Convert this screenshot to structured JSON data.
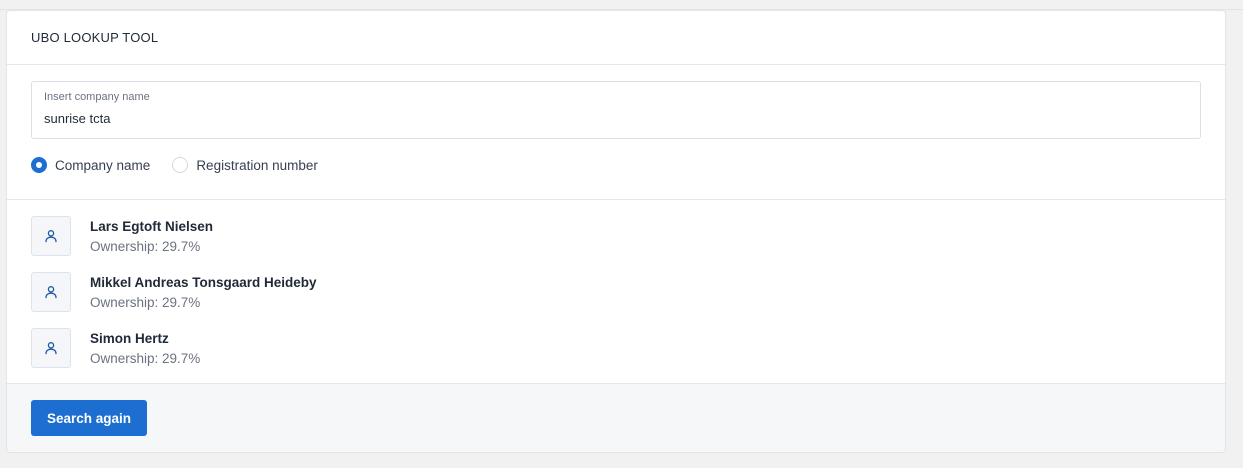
{
  "card": {
    "title": "UBO LOOKUP TOOL"
  },
  "search": {
    "label": "Insert company name",
    "value": "sunrise tcta",
    "options": [
      {
        "label": "Company name",
        "selected": true
      },
      {
        "label": "Registration number",
        "selected": false
      }
    ]
  },
  "results": [
    {
      "name": "Lars Egtoft Nielsen",
      "ownership": "Ownership: 29.7%",
      "icon": "user-icon"
    },
    {
      "name": "Mikkel Andreas Tonsgaard Heideby",
      "ownership": "Ownership: 29.7%",
      "icon": "user-icon"
    },
    {
      "name": "Simon Hertz",
      "ownership": "Ownership: 29.7%",
      "icon": "user-icon"
    }
  ],
  "footer": {
    "button_label": "Search again"
  },
  "colors": {
    "accent": "#1c6fd1",
    "icon": "#1c5aa8"
  }
}
